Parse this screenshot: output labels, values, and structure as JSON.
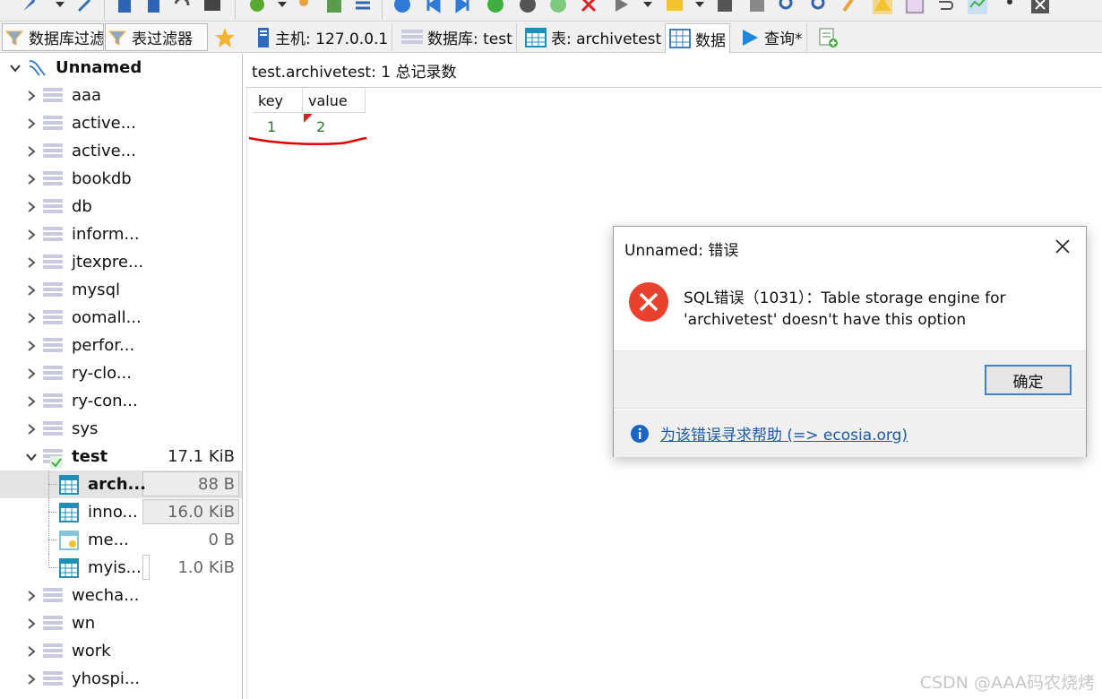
{
  "toolbar": {
    "icons": [
      "connect-icon",
      "dropdown-icon",
      "wand-icon",
      "new-query-icon",
      "copy-icon",
      "undo-icon",
      "print-icon",
      "refresh-icon",
      "dropdown-icon",
      "user-icon",
      "csv-export-icon",
      "transfer-icon",
      "help-icon",
      "first-record-icon",
      "last-record-icon",
      "add-record-icon",
      "delete-record-icon",
      "apply-icon",
      "cancel-icon",
      "run-icon",
      "dropdown-icon",
      "folder-icon",
      "dropdown-icon",
      "save-icon",
      "save-disk-icon",
      "find-icon",
      "replace-icon",
      "broom-icon",
      "warning-icon",
      "binary-icon",
      "wrap-icon",
      "format-icon",
      "comma-icon",
      "close-icon"
    ]
  },
  "filters": {
    "db_filter": "数据库过滤",
    "table_filter": "表过滤器"
  },
  "tabs": [
    {
      "icon": "server-icon",
      "label": "主机: 127.0.0.1"
    },
    {
      "icon": "database-icon",
      "label": "数据库: test"
    },
    {
      "icon": "table-icon",
      "label": "表: archivetest"
    },
    {
      "icon": "data-grid-icon",
      "label": "数据"
    },
    {
      "icon": "query-icon",
      "label": "查询*"
    },
    {
      "icon": "new-query-tab-icon",
      "label": ""
    }
  ],
  "tree": {
    "root": "Unnamed",
    "databases": [
      "aaa",
      "active...",
      "active...",
      "bookdb",
      "db",
      "inform...",
      "jtexpre...",
      "mysql",
      "oomall...",
      "perfor...",
      "ry-clo...",
      "ry-con...",
      "sys"
    ],
    "expanded": {
      "name": "test",
      "size": "17.1 KiB",
      "tables": [
        {
          "name": "arch...",
          "size": "88 B",
          "icon": "table-icon"
        },
        {
          "name": "inno...",
          "size": "16.0 KiB",
          "icon": "table-icon"
        },
        {
          "name": "me...",
          "size": "0 B",
          "icon": "memory-table-icon"
        },
        {
          "name": "myis...",
          "size": "1.0 KiB",
          "icon": "table-icon"
        }
      ]
    },
    "databases_after": [
      "wecha...",
      "wn",
      "work",
      "yhospi..."
    ]
  },
  "main": {
    "status": "test.archivetest: 1 总记录数",
    "columns": [
      "key",
      "value"
    ],
    "rows": [
      [
        "1",
        "2"
      ]
    ]
  },
  "dialog": {
    "title": "Unnamed: 错误",
    "message_line1": "SQL错误（1031）：Table storage engine for",
    "message_line2": "'archivetest' doesn't have this option",
    "ok_label": "确定",
    "help_link": "为该错误寻求帮助 (=> ecosia.org)"
  },
  "watermark": "CSDN @AAA码农烧烤",
  "colors": {
    "error_red": "#e8412e",
    "selection_gray": "#e3e3e3",
    "link_blue": "#1a5aa8",
    "value_green": "#2a7a2a",
    "annotation_red": "#e00000"
  }
}
